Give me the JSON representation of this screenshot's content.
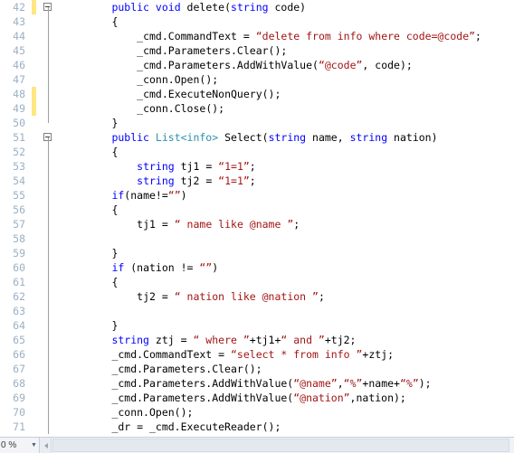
{
  "editor": {
    "language": "csharp",
    "colors": {
      "background": "#ffffff",
      "keyword": "#0000ff",
      "type": "#2b91af",
      "string": "#a31515",
      "plain": "#000000",
      "line_number": "#9ab0c4",
      "change_marker": "#ffe680",
      "outline_line": "#a0a0a0"
    },
    "lines": [
      {
        "num": "42",
        "indent": 8,
        "changed": true,
        "outline": "box-start",
        "tokens": [
          {
            "t": "public",
            "c": "kw"
          },
          {
            "t": " ",
            "c": "pln"
          },
          {
            "t": "void",
            "c": "kw"
          },
          {
            "t": " delete(",
            "c": "pln"
          },
          {
            "t": "string",
            "c": "kw"
          },
          {
            "t": " code)",
            "c": "pln"
          }
        ]
      },
      {
        "num": "43",
        "indent": 8,
        "changed": false,
        "outline": "line",
        "tokens": [
          {
            "t": "{",
            "c": "pln"
          }
        ]
      },
      {
        "num": "44",
        "indent": 12,
        "changed": false,
        "outline": "line",
        "tokens": [
          {
            "t": "_cmd.CommandText = ",
            "c": "pln"
          },
          {
            "t": "“delete from info where code=@code”",
            "c": "str"
          },
          {
            "t": ";",
            "c": "pln"
          }
        ]
      },
      {
        "num": "45",
        "indent": 12,
        "changed": false,
        "outline": "line",
        "tokens": [
          {
            "t": "_cmd.Parameters.Clear();",
            "c": "pln"
          }
        ]
      },
      {
        "num": "46",
        "indent": 12,
        "changed": false,
        "outline": "line",
        "tokens": [
          {
            "t": "_cmd.Parameters.AddWithValue(",
            "c": "pln"
          },
          {
            "t": "“@code”",
            "c": "str"
          },
          {
            "t": ", code);",
            "c": "pln"
          }
        ]
      },
      {
        "num": "47",
        "indent": 12,
        "changed": false,
        "outline": "line",
        "tokens": [
          {
            "t": "_conn.Open();",
            "c": "pln"
          }
        ]
      },
      {
        "num": "48",
        "indent": 12,
        "changed": true,
        "outline": "line",
        "tokens": [
          {
            "t": "_cmd.ExecuteNonQuery();",
            "c": "pln"
          }
        ]
      },
      {
        "num": "49",
        "indent": 12,
        "changed": true,
        "outline": "line",
        "tokens": [
          {
            "t": "_conn.Close();",
            "c": "pln"
          }
        ]
      },
      {
        "num": "50",
        "indent": 8,
        "changed": false,
        "outline": "line-end",
        "tokens": [
          {
            "t": "}",
            "c": "pln"
          }
        ]
      },
      {
        "num": "51",
        "indent": 8,
        "changed": false,
        "outline": "box-start",
        "tokens": [
          {
            "t": "public",
            "c": "kw"
          },
          {
            "t": " ",
            "c": "pln"
          },
          {
            "t": "List<info>",
            "c": "typ"
          },
          {
            "t": " Select(",
            "c": "pln"
          },
          {
            "t": "string",
            "c": "kw"
          },
          {
            "t": " name, ",
            "c": "pln"
          },
          {
            "t": "string",
            "c": "kw"
          },
          {
            "t": " nation)",
            "c": "pln"
          }
        ]
      },
      {
        "num": "52",
        "indent": 8,
        "changed": false,
        "outline": "line",
        "tokens": [
          {
            "t": "{",
            "c": "pln"
          }
        ]
      },
      {
        "num": "53",
        "indent": 12,
        "changed": false,
        "outline": "line",
        "tokens": [
          {
            "t": "string",
            "c": "kw"
          },
          {
            "t": " tj1 = ",
            "c": "pln"
          },
          {
            "t": "“1=1”",
            "c": "str"
          },
          {
            "t": ";",
            "c": "pln"
          }
        ]
      },
      {
        "num": "54",
        "indent": 12,
        "changed": false,
        "outline": "line",
        "tokens": [
          {
            "t": "string",
            "c": "kw"
          },
          {
            "t": " tj2 = ",
            "c": "pln"
          },
          {
            "t": "“1=1”",
            "c": "str"
          },
          {
            "t": ";",
            "c": "pln"
          }
        ]
      },
      {
        "num": "55",
        "indent": 8,
        "changed": false,
        "outline": "line",
        "tokens": [
          {
            "t": "if",
            "c": "kw"
          },
          {
            "t": "(name!=",
            "c": "pln"
          },
          {
            "t": "“”",
            "c": "str"
          },
          {
            "t": ")",
            "c": "pln"
          }
        ]
      },
      {
        "num": "56",
        "indent": 8,
        "changed": false,
        "outline": "line",
        "tokens": [
          {
            "t": "{",
            "c": "pln"
          }
        ]
      },
      {
        "num": "57",
        "indent": 12,
        "changed": false,
        "outline": "line",
        "tokens": [
          {
            "t": "tj1 = ",
            "c": "pln"
          },
          {
            "t": "“ name like @name ”",
            "c": "str"
          },
          {
            "t": ";",
            "c": "pln"
          }
        ]
      },
      {
        "num": "58",
        "indent": 8,
        "changed": false,
        "outline": "line",
        "tokens": [
          {
            "t": "",
            "c": "pln"
          }
        ]
      },
      {
        "num": "59",
        "indent": 8,
        "changed": false,
        "outline": "line",
        "tokens": [
          {
            "t": "}",
            "c": "pln"
          }
        ]
      },
      {
        "num": "60",
        "indent": 8,
        "changed": false,
        "outline": "line",
        "tokens": [
          {
            "t": "if",
            "c": "kw"
          },
          {
            "t": " (nation != ",
            "c": "pln"
          },
          {
            "t": "“”",
            "c": "str"
          },
          {
            "t": ")",
            "c": "pln"
          }
        ]
      },
      {
        "num": "61",
        "indent": 8,
        "changed": false,
        "outline": "line",
        "tokens": [
          {
            "t": "{",
            "c": "pln"
          }
        ]
      },
      {
        "num": "62",
        "indent": 12,
        "changed": false,
        "outline": "line",
        "tokens": [
          {
            "t": "tj2 = ",
            "c": "pln"
          },
          {
            "t": "“ nation like @nation ”",
            "c": "str"
          },
          {
            "t": ";",
            "c": "pln"
          }
        ]
      },
      {
        "num": "63",
        "indent": 8,
        "changed": false,
        "outline": "line",
        "tokens": [
          {
            "t": "",
            "c": "pln"
          }
        ]
      },
      {
        "num": "64",
        "indent": 8,
        "changed": false,
        "outline": "line",
        "tokens": [
          {
            "t": "}",
            "c": "pln"
          }
        ]
      },
      {
        "num": "65",
        "indent": 8,
        "changed": false,
        "outline": "line",
        "tokens": [
          {
            "t": "string",
            "c": "kw"
          },
          {
            "t": " ztj = ",
            "c": "pln"
          },
          {
            "t": "“ where ”",
            "c": "str"
          },
          {
            "t": "+tj1+",
            "c": "pln"
          },
          {
            "t": "“ and ”",
            "c": "str"
          },
          {
            "t": "+tj2;",
            "c": "pln"
          }
        ]
      },
      {
        "num": "66",
        "indent": 8,
        "changed": false,
        "outline": "line",
        "tokens": [
          {
            "t": "_cmd.CommandText = ",
            "c": "pln"
          },
          {
            "t": "“select * from info ”",
            "c": "str"
          },
          {
            "t": "+ztj;",
            "c": "pln"
          }
        ]
      },
      {
        "num": "67",
        "indent": 8,
        "changed": false,
        "outline": "line",
        "tokens": [
          {
            "t": "_cmd.Parameters.Clear();",
            "c": "pln"
          }
        ]
      },
      {
        "num": "68",
        "indent": 8,
        "changed": false,
        "outline": "line",
        "tokens": [
          {
            "t": "_cmd.Parameters.AddWithValue(",
            "c": "pln"
          },
          {
            "t": "“@name”",
            "c": "str"
          },
          {
            "t": ",",
            "c": "pln"
          },
          {
            "t": "“%”",
            "c": "str"
          },
          {
            "t": "+name+",
            "c": "pln"
          },
          {
            "t": "“%”",
            "c": "str"
          },
          {
            "t": ");",
            "c": "pln"
          }
        ]
      },
      {
        "num": "69",
        "indent": 8,
        "changed": false,
        "outline": "line",
        "tokens": [
          {
            "t": "_cmd.Parameters.AddWithValue(",
            "c": "pln"
          },
          {
            "t": "“@nation”",
            "c": "str"
          },
          {
            "t": ",nation);",
            "c": "pln"
          }
        ]
      },
      {
        "num": "70",
        "indent": 8,
        "changed": false,
        "outline": "line",
        "tokens": [
          {
            "t": "_conn.Open();",
            "c": "pln"
          }
        ]
      },
      {
        "num": "71",
        "indent": 8,
        "changed": false,
        "outline": "line",
        "tokens": [
          {
            "t": "_dr = _cmd.ExecuteReader();",
            "c": "pln"
          }
        ]
      }
    ]
  },
  "statusbar": {
    "zoom_level": "0 %",
    "zoom_caret": "▼",
    "scroll_left_arrow": "◀"
  }
}
